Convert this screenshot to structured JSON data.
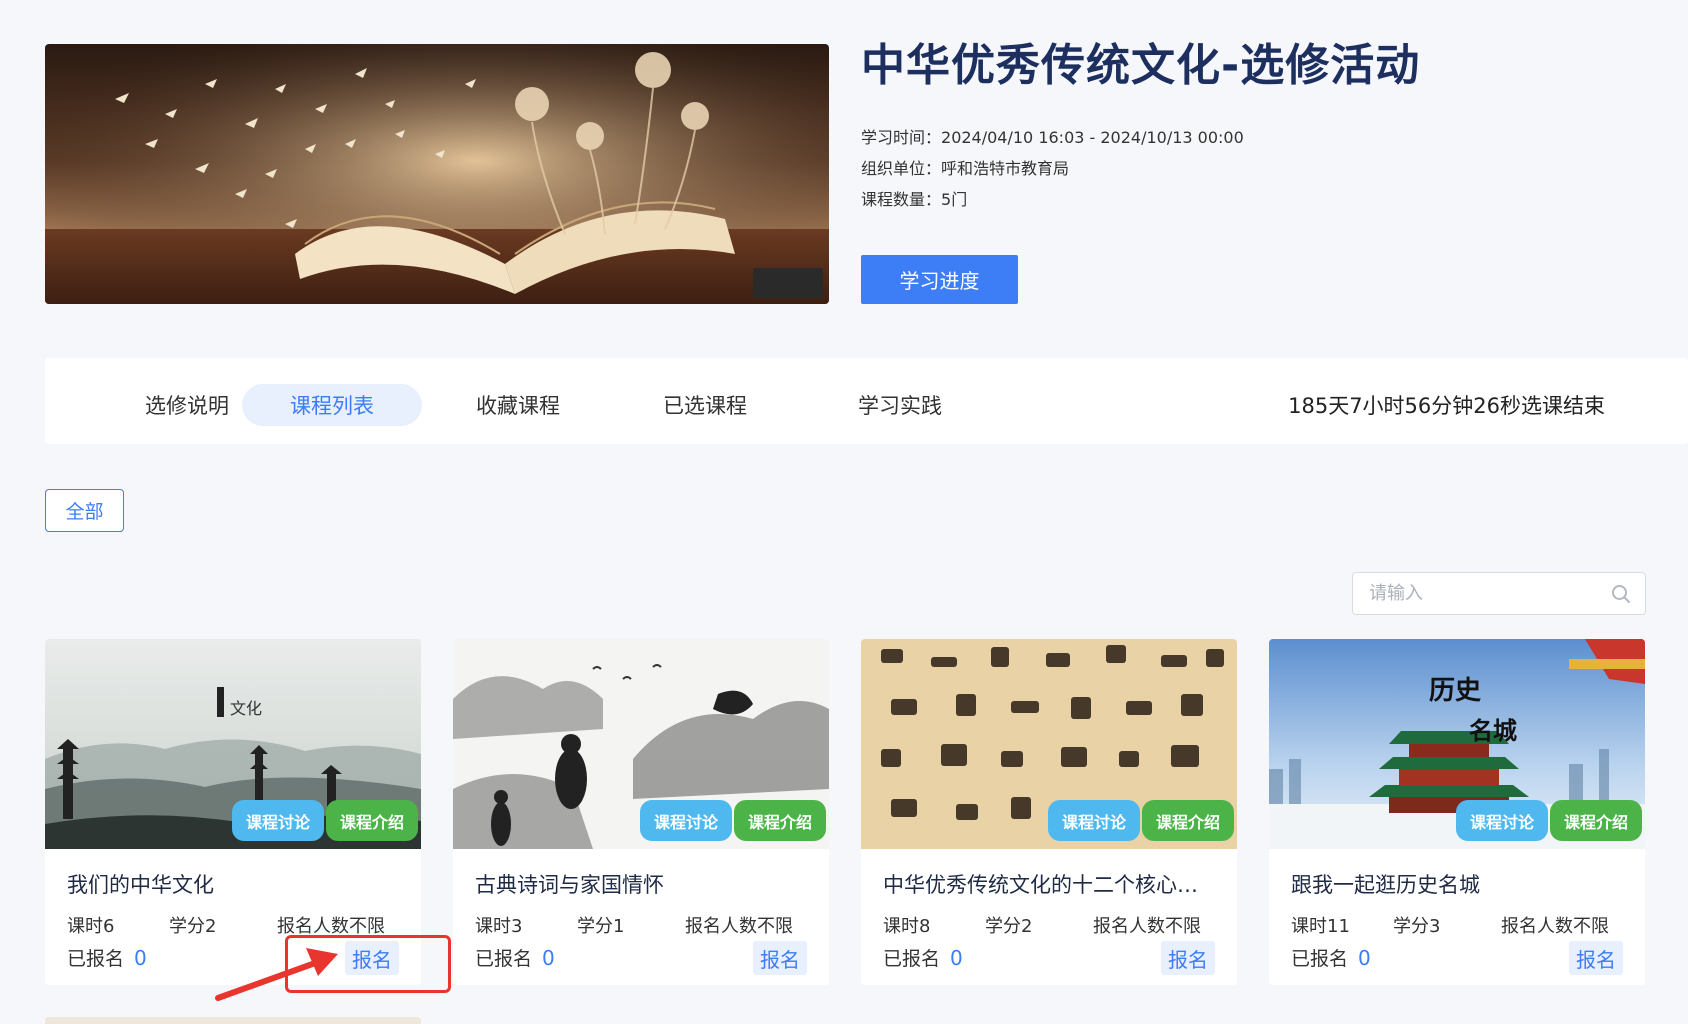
{
  "banner": {
    "title": "中华优秀传统文化-选修活动",
    "study_time_label": "学习时间：",
    "study_time_value": "2024/04/10 16:03 - 2024/10/13 00:00",
    "org_label": "组织单位：",
    "org_value": "呼和浩特市教育局",
    "course_count_label": "课程数量：",
    "course_count_value": "5门",
    "progress_button": "学习进度"
  },
  "tabs": [
    {
      "label": "选修说明",
      "active": false
    },
    {
      "label": "课程列表",
      "active": true
    },
    {
      "label": "收藏课程",
      "active": false
    },
    {
      "label": "已选课程",
      "active": false
    },
    {
      "label": "学习实践",
      "active": false
    }
  ],
  "countdown": "185天7小时56分钟26秒选课结束",
  "filter": {
    "all_label": "全部"
  },
  "search": {
    "placeholder": "请输入"
  },
  "chips": {
    "discuss": "课程讨论",
    "intro": "课程介绍"
  },
  "courses": [
    {
      "title": "我们的中华文化",
      "hours": "课时6",
      "credits": "学分2",
      "limit": "报名人数不限",
      "enrolled_label": "已报名",
      "enrolled_count": "0",
      "enroll_button": "报名"
    },
    {
      "title": "古典诗词与家国情怀",
      "hours": "课时3",
      "credits": "学分1",
      "limit": "报名人数不限",
      "enrolled_label": "已报名",
      "enrolled_count": "0",
      "enroll_button": "报名"
    },
    {
      "title": "中华优秀传统文化的十二个核心…",
      "hours": "课时8",
      "credits": "学分2",
      "limit": "报名人数不限",
      "enrolled_label": "已报名",
      "enrolled_count": "0",
      "enroll_button": "报名"
    },
    {
      "title": "跟我一起逛历史名城",
      "hours": "课时11",
      "credits": "学分3",
      "limit": "报名人数不限",
      "enrolled_label": "已报名",
      "enrolled_count": "0",
      "enroll_button": "报名"
    }
  ],
  "colors": {
    "primary": "#3d7df5",
    "title": "#1d2f5e",
    "discuss_chip": "#4eb8ef",
    "intro_chip": "#4cb348",
    "annotation": "#e8362f"
  }
}
